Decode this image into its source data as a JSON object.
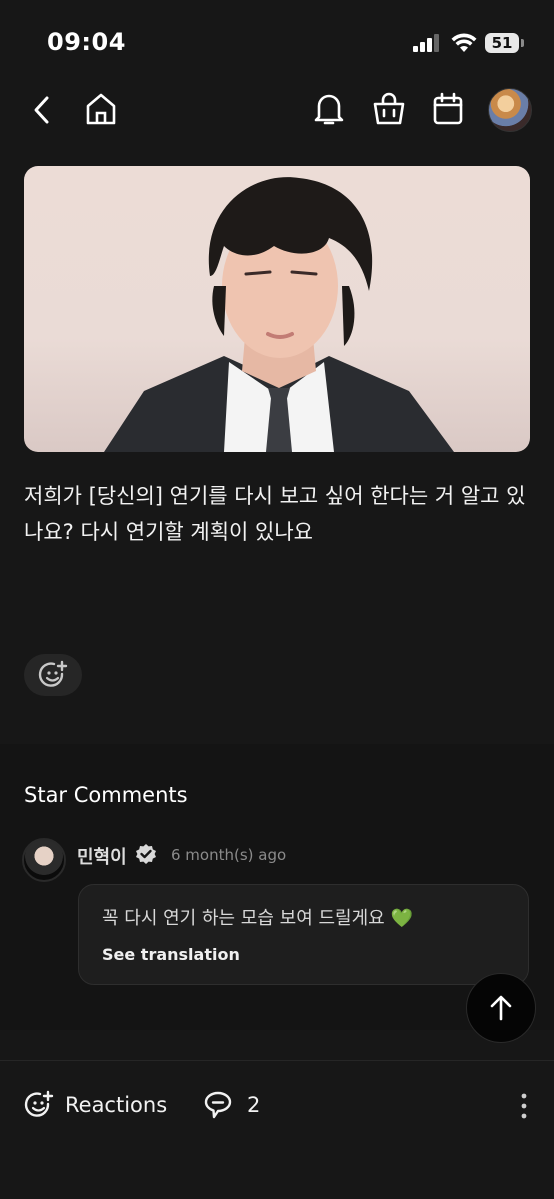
{
  "status_bar": {
    "time": "09:04",
    "battery_level": "51"
  },
  "header": {
    "back_icon": "chevron-left-icon",
    "home_icon": "home-icon",
    "bell_icon": "bell-icon",
    "shop_icon": "shopping-bag-icon",
    "calendar_icon": "calendar-icon"
  },
  "post": {
    "text": "저희가 [당신의] 연기를 다시 보고 싶어 한다는 거 알고 있나요? 다시 연기할 계획이 있나요"
  },
  "star_comments": {
    "title": "Star Comments",
    "comment": {
      "author": "민혁이",
      "time": "6 month(s) ago",
      "text": "꼭 다시 연기 하는 모습 보여 드릴게요",
      "emoji": "💚",
      "translate_label": "See translation"
    }
  },
  "bottom_bar": {
    "reactions_label": "Reactions",
    "comments_count": "2"
  },
  "colors": {
    "background": "#171717",
    "bubble": "#1e1e1e",
    "heart": "#3ddc5a"
  }
}
